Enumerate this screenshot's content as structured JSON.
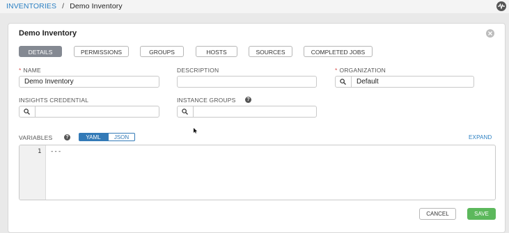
{
  "breadcrumb": {
    "root": "INVENTORIES",
    "separator": "/",
    "current": "Demo Inventory"
  },
  "header_icons": {
    "activity": "activity-stream-icon"
  },
  "card": {
    "title": "Demo Inventory",
    "close_icon": "close-icon"
  },
  "tabs": [
    {
      "label": "DETAILS",
      "active": true
    },
    {
      "label": "PERMISSIONS",
      "active": false
    },
    {
      "label": "GROUPS",
      "active": false
    },
    {
      "label": "HOSTS",
      "active": false
    },
    {
      "label": "SOURCES",
      "active": false
    },
    {
      "label": "COMPLETED JOBS",
      "active": false
    }
  ],
  "fields": {
    "name": {
      "required_mark": "*",
      "label": "NAME",
      "value": "Demo Inventory"
    },
    "description": {
      "label": "DESCRIPTION",
      "value": ""
    },
    "organization": {
      "required_mark": "*",
      "label": "ORGANIZATION",
      "value": "Default"
    },
    "insights_credential": {
      "label": "INSIGHTS CREDENTIAL",
      "value": ""
    },
    "instance_groups": {
      "label": "INSTANCE GROUPS",
      "help": "?",
      "value": ""
    }
  },
  "variables": {
    "label": "VARIABLES",
    "help": "?",
    "toggle": {
      "yaml": "YAML",
      "json": "JSON",
      "selected": "YAML"
    },
    "expand": "EXPAND",
    "line_number": "1",
    "content": "---"
  },
  "actions": {
    "cancel": "CANCEL",
    "save": "SAVE"
  },
  "colors": {
    "accent": "#337ab7",
    "save": "#5cb85c",
    "active_tab": "#848992",
    "required": "#d9534f"
  }
}
